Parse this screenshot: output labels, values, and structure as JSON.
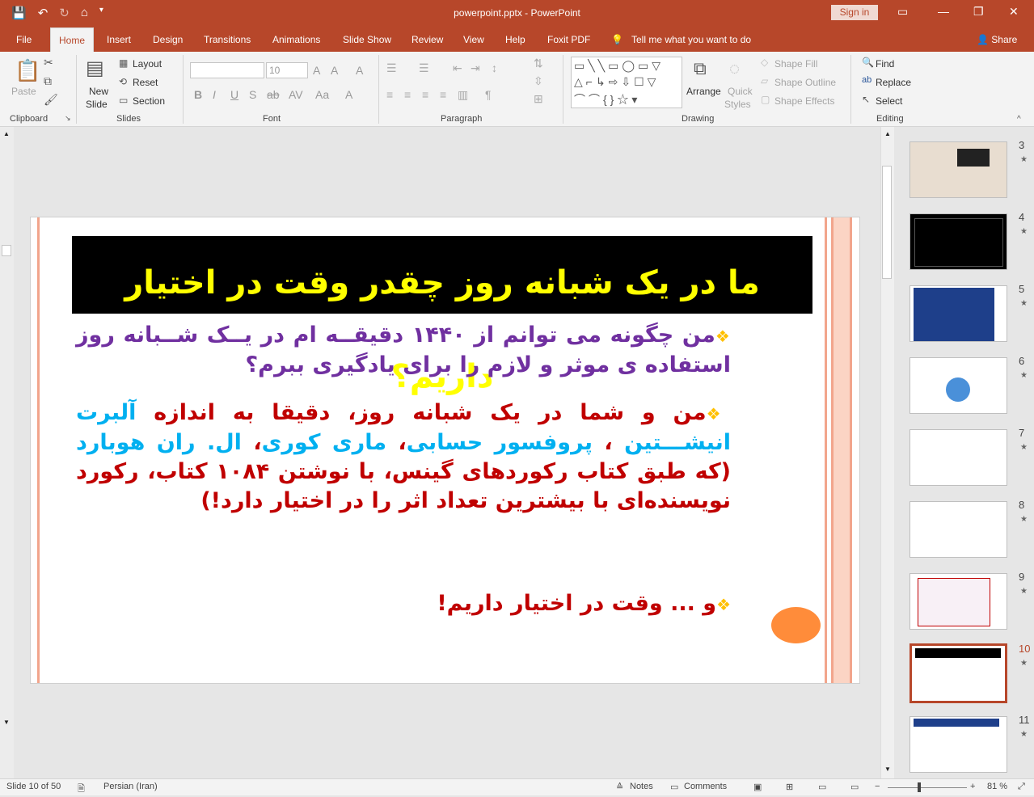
{
  "titlebar": {
    "title": "powerpoint.pptx  -  PowerPoint",
    "signin": "Sign in"
  },
  "tabs": [
    "File",
    "Home",
    "Insert",
    "Design",
    "Transitions",
    "Animations",
    "Slide Show",
    "Review",
    "View",
    "Help",
    "Foxit PDF"
  ],
  "tell_me": "Tell me what you want to do",
  "share": "Share",
  "ribbon": {
    "clipboard": {
      "label": "Clipboard",
      "paste": "Paste"
    },
    "slides": {
      "label": "Slides",
      "new_slide_1": "New",
      "new_slide_2": "Slide",
      "layout": "Layout",
      "reset": "Reset",
      "section": "Section"
    },
    "font": {
      "label": "Font",
      "size": "10"
    },
    "paragraph": {
      "label": "Paragraph"
    },
    "drawing": {
      "label": "Drawing",
      "arrange": "Arrange",
      "quick_styles_1": "Quick",
      "quick_styles_2": "Styles",
      "shape_fill": "Shape Fill",
      "shape_outline": "Shape Outline",
      "shape_effects": "Shape Effects"
    },
    "editing": {
      "label": "Editing",
      "find": "Find",
      "replace": "Replace",
      "select": "Select"
    }
  },
  "slide": {
    "title": "ما در یک شبانه روز چقدر وقت در اختیار داریم؟",
    "p1": "من چگونه می توانم از ۱۴۴۰ دقیقــه ام در یــک شــبانه روز استفاده ی موثر و لازم را برای یادگیری ببرم؟",
    "p2_a": "من و شما در یک شبانه روز، دقیقا به اندازه ",
    "p2_b": "آلبرت انیشـــتین",
    "p2_c": " ، ",
    "p2_d": "پروفسور حسابی",
    "p2_e": "، ",
    "p2_f": "ماری کوری",
    "p2_g": "، ",
    "p2_h": "ال. ران هوبارد",
    "p2_i": " (که طبق کتاب رکوردهای گینس، با نوشتن ۱۰۸۴ کتاب، رکورد نویسنده‌ای با بیشترین تعداد اثر را در اختیار دارد!)",
    "p3": "و ... وقت در اختیار داریم!"
  },
  "thumbnails": [
    {
      "num": "3",
      "selected": false
    },
    {
      "num": "4",
      "selected": false
    },
    {
      "num": "5",
      "selected": false
    },
    {
      "num": "6",
      "selected": false
    },
    {
      "num": "7",
      "selected": false
    },
    {
      "num": "8",
      "selected": false
    },
    {
      "num": "9",
      "selected": false
    },
    {
      "num": "10",
      "selected": true
    },
    {
      "num": "11",
      "selected": false
    }
  ],
  "status": {
    "slide": "Slide 10 of 50",
    "language": "Persian (Iran)",
    "notes": "Notes",
    "comments": "Comments",
    "zoom": "81 %"
  },
  "colors": {
    "accent": "#b7472a",
    "title_bg": "#000000",
    "title_text": "#ffff00",
    "purple": "#7030a0",
    "red": "#c00000",
    "cyan": "#00b0f0"
  }
}
